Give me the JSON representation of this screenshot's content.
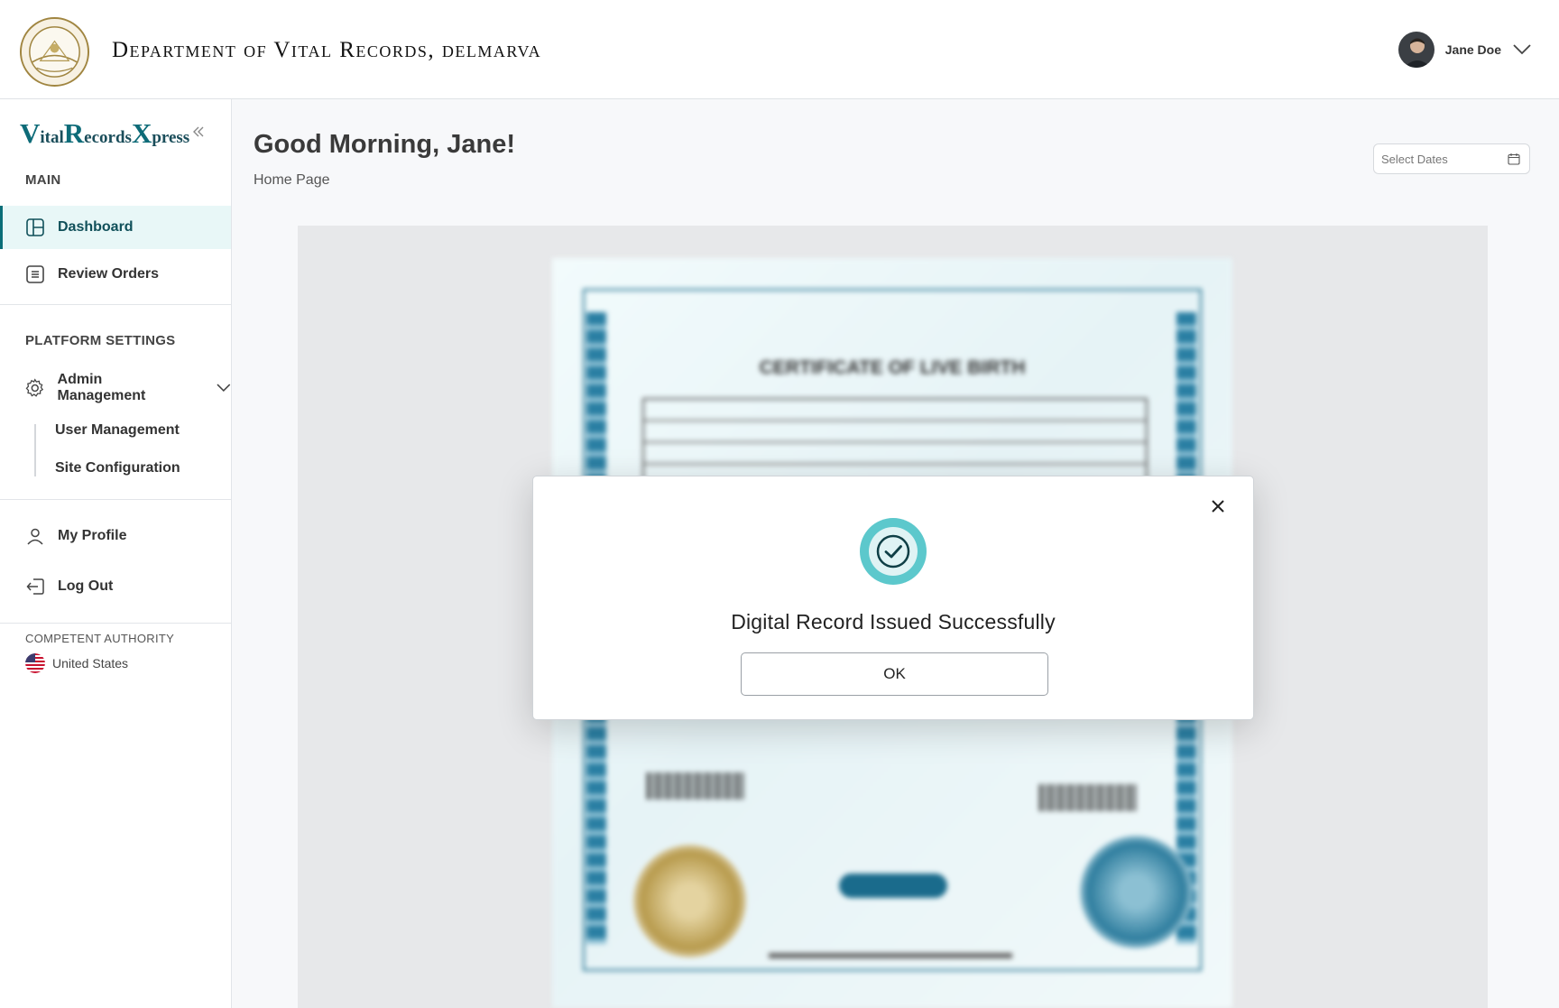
{
  "header": {
    "department_title": "Department of Vital Records, delmarva",
    "seal_text": "DEPARTMENT OF VITAL RECORDS · DELMARVA",
    "user_name": "Jane Doe"
  },
  "sidebar": {
    "brand": {
      "v": "V",
      "ital": "ital",
      "r": "R",
      "ecords": "ecords",
      "x": "X",
      "press": "press"
    },
    "main_heading": "MAIN",
    "items": [
      {
        "label": "Dashboard",
        "icon": "dashboard-icon",
        "active": true
      },
      {
        "label": "Review Orders",
        "icon": "list-icon",
        "active": false
      }
    ],
    "platform_heading": "PLATFORM SETTINGS",
    "admin_label": "Admin Management",
    "admin_subitems": [
      "User Management",
      "Site Configuration"
    ],
    "profile_label": "My Profile",
    "logout_label": "Log Out",
    "authority_heading": "COMPETENT AUTHORITY",
    "authority_country": "United States"
  },
  "main": {
    "greeting": "Good Morning, Jane!",
    "breadcrumb": "Home Page",
    "date_picker_placeholder": "Select Dates"
  },
  "document": {
    "title": "CERTIFICATE OF LIVE BIRTH"
  },
  "modal": {
    "message": "Digital Record Issued Successfully",
    "ok_label": "OK"
  },
  "colors": {
    "accent": "#0b6e78",
    "success_ring": "#5cc8cc",
    "active_bg": "#e8f7f7"
  }
}
